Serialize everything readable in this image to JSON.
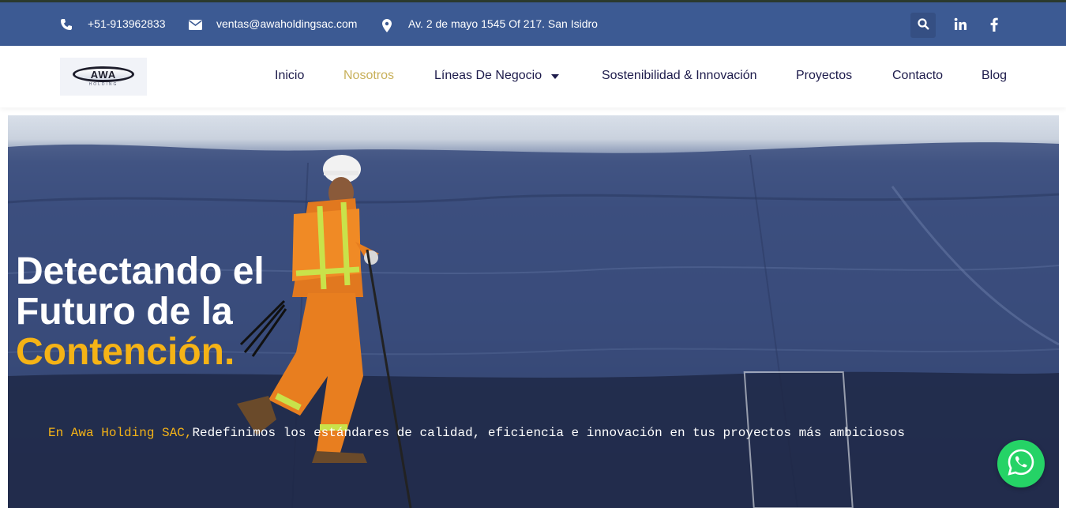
{
  "topbar": {
    "phone": "+51-913962833",
    "email": "ventas@awaholdingsac.com",
    "address": "Av. 2 de mayo 1545 Of 217. San Isidro",
    "icons": {
      "phone": "phone-icon",
      "email": "envelope-icon",
      "address": "map-pin-icon",
      "search": "search-icon",
      "linkedin": "linkedin-icon",
      "facebook": "facebook-icon"
    }
  },
  "logo": {
    "word": "AWA",
    "sub": "HOLDING"
  },
  "nav": {
    "items": [
      "Inicio",
      "Nosotros",
      "Líneas De Negocio",
      "Sostenibilidad & Innovación",
      "Proyectos",
      "Contacto",
      "Blog"
    ],
    "active": "Nosotros"
  },
  "hero": {
    "title_line1": "Detectando el",
    "title_line2": "Futuro de la",
    "title_accent": "Contención.",
    "subtitle_accent": "En Awa Holding SAC,",
    "subtitle": "Redefinimos los estándares de calidad, eficiencia e innovación en tus proyectos más ambiciosos"
  },
  "colors": {
    "topbar": "#3c5a93",
    "nav_text": "#1d1b4b",
    "nav_active": "#c8b05a",
    "accent": "#f5b316",
    "whatsapp": "#25d366"
  }
}
